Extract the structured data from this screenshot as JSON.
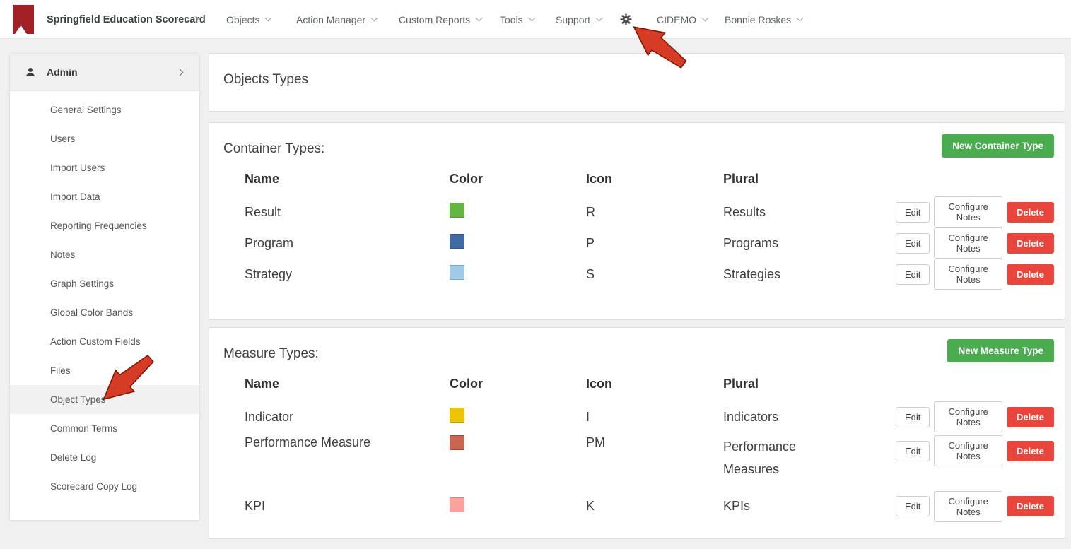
{
  "theme": {
    "logo_red": "#a32126",
    "arrow_red": "#d63b25",
    "arrow_outline": "#7a1505",
    "accent_green": "#4aab4f",
    "delete_red": "#e8463d"
  },
  "topnav": {
    "brand": {
      "label": "Springfield Education Scorecard"
    },
    "menus": [
      {
        "label": "Objects"
      },
      {
        "label": "Action Manager"
      },
      {
        "label": "Custom Reports"
      },
      {
        "label": "Tools"
      },
      {
        "label": "Support"
      }
    ],
    "settings_icon": "gear-icon",
    "scorecard": {
      "label": "CIDEMO"
    },
    "user": {
      "label": "Bonnie Roskes"
    }
  },
  "sidebar": {
    "header": {
      "label": "Admin"
    },
    "items": [
      {
        "label": "General Settings"
      },
      {
        "label": "Users"
      },
      {
        "label": "Import Users"
      },
      {
        "label": "Import Data"
      },
      {
        "label": "Reporting Frequencies"
      },
      {
        "label": "Notes"
      },
      {
        "label": "Graph Settings"
      },
      {
        "label": "Global Color Bands"
      },
      {
        "label": "Action Custom Fields"
      },
      {
        "label": "Files"
      },
      {
        "label": "Object Types",
        "active": true
      },
      {
        "label": "Common Terms"
      },
      {
        "label": "Delete Log"
      },
      {
        "label": "Scorecard Copy Log"
      }
    ]
  },
  "main": {
    "page_title": "Objects Types",
    "container_section": {
      "title": "Container Types:",
      "new_button": "New Container Type",
      "columns": {
        "name": "Name",
        "color": "Color",
        "icon": "Icon",
        "plural": "Plural"
      },
      "rows": [
        {
          "name": "Result",
          "icon": "R",
          "plural": "Results",
          "color": "#65b445",
          "color_border": "#4f9d35"
        },
        {
          "name": "Program",
          "icon": "P",
          "plural": "Programs",
          "color": "#4169a3",
          "color_border": "#305694"
        },
        {
          "name": "Strategy",
          "icon": "S",
          "plural": "Strategies",
          "color": "#9fcbe9",
          "color_border": "#7fa9c6"
        }
      ],
      "actions": {
        "edit": "Edit",
        "configure": "Configure Notes",
        "delete": "Delete"
      }
    },
    "measure_section": {
      "title": "Measure Types:",
      "new_button": "New Measure Type",
      "columns": {
        "name": "Name",
        "color": "Color",
        "icon": "Icon",
        "plural": "Plural"
      },
      "rows": [
        {
          "name": "Indicator",
          "icon": "I",
          "plural": "Indicators",
          "color": "#eec504",
          "color_border": "#c3a206"
        },
        {
          "name": "Performance Measure",
          "icon": "PM",
          "plural": "Performance Measures",
          "color": "#c96551",
          "color_border": "#a04a36"
        },
        {
          "name": "KPI",
          "icon": "K",
          "plural": "KPIs",
          "color": "#fca19b",
          "color_border": "#d4837f"
        }
      ],
      "actions": {
        "edit": "Edit",
        "configure": "Configure Notes",
        "delete": "Delete"
      }
    }
  }
}
